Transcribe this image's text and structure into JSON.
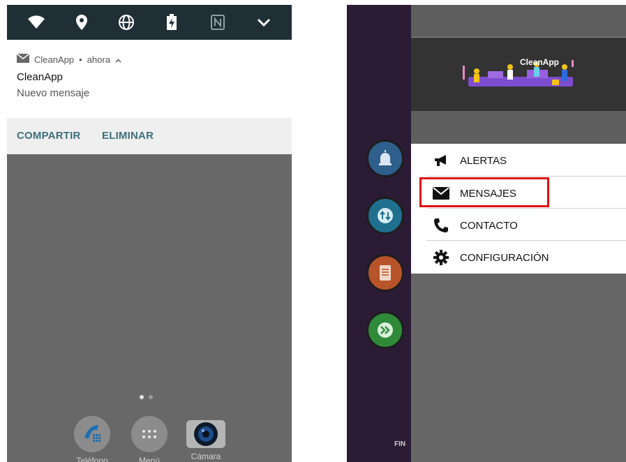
{
  "left_phone": {
    "status_icons": [
      "wifi-icon",
      "location-pin-icon",
      "globe-icon",
      "battery-charging-icon",
      "nfc-icon",
      "chevron-down-icon"
    ],
    "notification": {
      "app_name": "CleanApp",
      "time": "ahora",
      "header_separator": "•",
      "title": "CleanApp",
      "body": "Nuevo mensaje"
    },
    "actions": {
      "share_label": "COMPARTIR",
      "delete_label": "ELIMINAR"
    },
    "dock": [
      {
        "label": "Teléfono",
        "icon": "phone-icon"
      },
      {
        "label": "Menú",
        "icon": "app-grid-icon"
      },
      {
        "label": "Cámara",
        "icon": "camera-icon"
      }
    ],
    "page_indicator": {
      "pages": 2,
      "current": 1
    }
  },
  "right_phone": {
    "drawer_logo_text": "CleanApp",
    "background_button_label": "FIN",
    "menu": [
      {
        "label": "ALERTAS",
        "icon": "megaphone-icon"
      },
      {
        "label": "MENSAJES",
        "icon": "envelope-icon",
        "highlighted": true
      },
      {
        "label": "CONTACTO",
        "icon": "phone-handset-icon"
      },
      {
        "label": "CONFIGURACIÓN",
        "icon": "gear-icon"
      }
    ],
    "highlight_color": "#e01010"
  },
  "colors": {
    "status_bar": "#1f2f35",
    "action_text": "#3d6f7c",
    "drawer_header": "#333333"
  }
}
